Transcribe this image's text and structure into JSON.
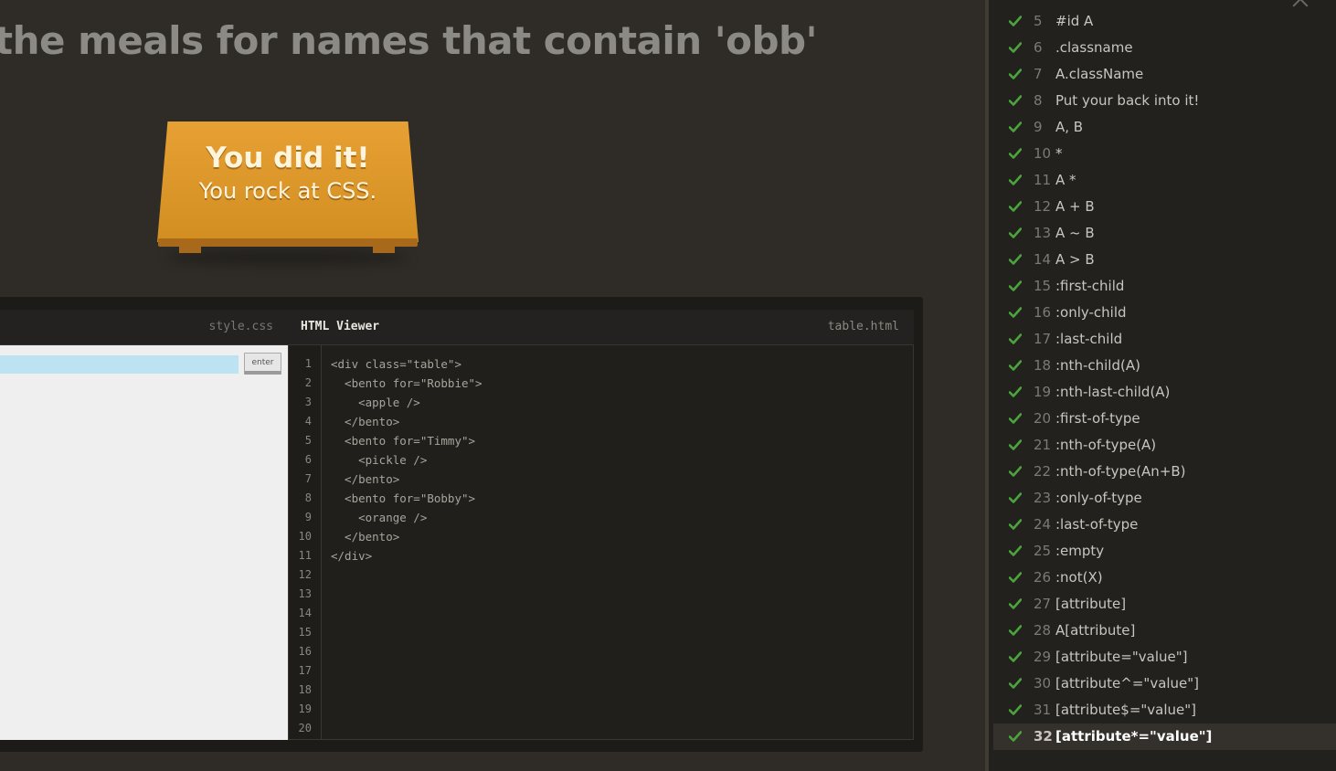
{
  "order_text": "the meals for names that contain 'obb'",
  "win": {
    "title": "You did it!",
    "subtitle": "You rock at CSS."
  },
  "editor": {
    "css_file": "style.css",
    "enter_label": "enter",
    "input_value": "",
    "html_title": "HTML Viewer",
    "html_file": "table.html",
    "line_numbers": [
      "1",
      "2",
      "3",
      "4",
      "5",
      "6",
      "7",
      "8",
      "9",
      "10",
      "11",
      "12",
      "13",
      "14",
      "15",
      "16",
      "17",
      "18",
      "19",
      "20"
    ],
    "code_lines": [
      "<div class=\"table\">",
      "  <bento for=\"Robbie\">",
      "    <apple />",
      "  </bento>",
      "  <bento for=\"Timmy\">",
      "    <pickle />",
      "  </bento>",
      "  <bento for=\"Bobby\">",
      "    <orange />",
      "  </bento>",
      "</div>"
    ]
  },
  "colors": {
    "check": "#4aa53c",
    "accent_table": "#e0992e"
  },
  "levels": [
    {
      "num": "5",
      "name": "#id  A"
    },
    {
      "num": "6",
      "name": ".classname"
    },
    {
      "num": "7",
      "name": "A.className"
    },
    {
      "num": "8",
      "name": "Put your back into it!"
    },
    {
      "num": "9",
      "name": "A, B"
    },
    {
      "num": "10",
      "name": "*"
    },
    {
      "num": "11",
      "name": "A  *"
    },
    {
      "num": "12",
      "name": "A + B"
    },
    {
      "num": "13",
      "name": "A ~ B"
    },
    {
      "num": "14",
      "name": "A > B"
    },
    {
      "num": "15",
      "name": ":first-child"
    },
    {
      "num": "16",
      "name": ":only-child"
    },
    {
      "num": "17",
      "name": ":last-child"
    },
    {
      "num": "18",
      "name": ":nth-child(A)"
    },
    {
      "num": "19",
      "name": ":nth-last-child(A)"
    },
    {
      "num": "20",
      "name": ":first-of-type"
    },
    {
      "num": "21",
      "name": ":nth-of-type(A)"
    },
    {
      "num": "22",
      "name": ":nth-of-type(An+B)"
    },
    {
      "num": "23",
      "name": ":only-of-type"
    },
    {
      "num": "24",
      "name": ":last-of-type"
    },
    {
      "num": "25",
      "name": ":empty"
    },
    {
      "num": "26",
      "name": ":not(X)"
    },
    {
      "num": "27",
      "name": "[attribute]"
    },
    {
      "num": "28",
      "name": "A[attribute]"
    },
    {
      "num": "29",
      "name": "[attribute=\"value\"]"
    },
    {
      "num": "30",
      "name": "[attribute^=\"value\"]"
    },
    {
      "num": "31",
      "name": "[attribute$=\"value\"]"
    },
    {
      "num": "32",
      "name": "[attribute*=\"value\"]",
      "current": true
    }
  ]
}
